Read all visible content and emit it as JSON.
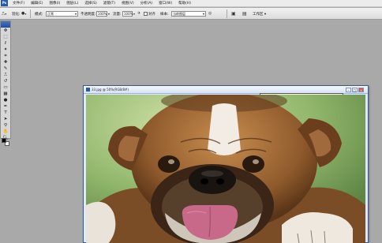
{
  "menubar": {
    "items": [
      "文件(F)",
      "编辑(E)",
      "图像(I)",
      "图层(L)",
      "选择(S)",
      "滤镜(T)",
      "视图(V)",
      "分析(A)",
      "窗口(W)",
      "帮助(H)"
    ]
  },
  "options": {
    "feather_label": "羽化:",
    "feather_value": "0 px",
    "mode_label": "模式:",
    "mode_value": "正常",
    "opacity_label": "不透明度:",
    "opacity_value": "100%",
    "flow_label": "流量:",
    "flow_value": "100%",
    "align_label": "对齐",
    "sample_label": "样本:",
    "sample_value": "当前图层",
    "workspace_label": "工作区 ▾"
  },
  "document": {
    "title": "33.jpg @ 50%(RGB/8#)",
    "tooltip": "C:\\Users\\Administrator\\Desktop\\33.jpg @ 50%(RGB/8#)",
    "image_subject": "bulldog photo"
  },
  "colors": {
    "workspace_bg": "#a9a9a9",
    "toolbox_head": "#1f4ea3",
    "foreground": "#000000",
    "background": "#ffffff"
  },
  "icons": {
    "toolbox": [
      "move-icon",
      "marquee-icon",
      "lasso-icon",
      "magic-wand-icon",
      "crop-icon",
      "slice-icon",
      "healing-brush-icon",
      "brush-icon",
      "clone-stamp-icon",
      "history-brush-icon",
      "eraser-icon",
      "gradient-icon",
      "blur-icon",
      "dodge-icon",
      "pen-icon",
      "text-icon",
      "path-select-icon",
      "shape-icon",
      "notes-icon",
      "eyedropper-icon",
      "hand-icon",
      "zoom-icon"
    ]
  }
}
